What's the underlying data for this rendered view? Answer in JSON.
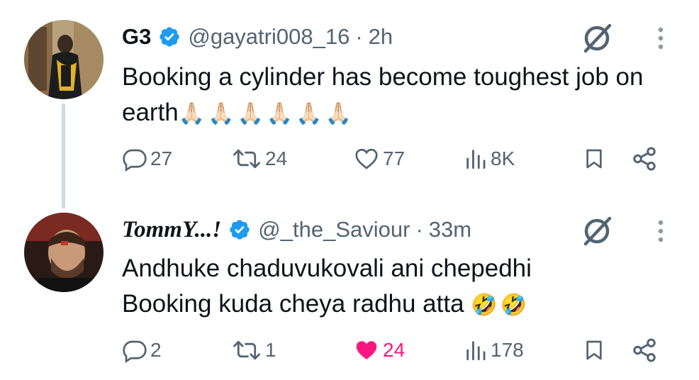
{
  "tweets": [
    {
      "display_name": "G3",
      "handle": "@gayatri008_16",
      "separator": "·",
      "time": "2h",
      "text": "Booking a cylinder has become toughest job on earth",
      "emojis": [
        "🙏🏻",
        "🙏🏻",
        "🙏🏻",
        "🙏🏻",
        "🙏🏻",
        "🙏🏻"
      ],
      "stats": {
        "replies": "27",
        "reposts": "24",
        "likes": "77",
        "views": "8K"
      },
      "liked": false
    },
    {
      "display_name": "TommY...!",
      "handle": "@_the_Saviour",
      "separator": "·",
      "time": "33m",
      "text_line1": "Andhuke chaduvukovali ani chepedhi",
      "text_line2": "Booking kuda cheya radhu atta",
      "emojis": [
        "🤣",
        "🤣"
      ],
      "stats": {
        "replies": "2",
        "reposts": "1",
        "likes": "24",
        "views": "178"
      },
      "liked": true
    }
  ],
  "colors": {
    "text": "#0f1419",
    "muted": "#536471",
    "verified": "#1d9bf0",
    "like_active": "#f91880",
    "thread_line": "#cfd9de"
  },
  "icons": {
    "reply": "reply-icon",
    "repost": "repost-icon",
    "like": "heart-icon",
    "views": "views-icon",
    "bookmark": "bookmark-icon",
    "share": "share-icon",
    "grok": "grok-icon",
    "more": "more-vertical-icon",
    "verified": "verified-badge-icon"
  }
}
